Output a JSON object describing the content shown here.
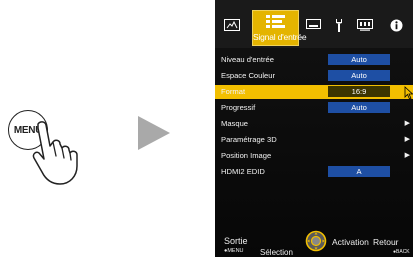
{
  "illustration": {
    "menu_button_label": "MENU"
  },
  "osd": {
    "active_tab_label": "Signal d'entrée",
    "tabs": [
      {
        "icon": "picture-icon"
      },
      {
        "icon": "input-signal-icon"
      },
      {
        "icon": "installation-icon"
      },
      {
        "icon": "setup-wrench-icon"
      },
      {
        "icon": "display-setup-icon"
      },
      {
        "icon": "info-icon"
      }
    ],
    "menu_items": [
      {
        "label": "Niveau d'entrée",
        "value": "Auto"
      },
      {
        "label": "Espace Couleur",
        "value": "Auto"
      },
      {
        "label": "Format",
        "value": "16:9"
      },
      {
        "label": "Progressif",
        "value": "Auto"
      },
      {
        "label": "Masque",
        "value": ""
      },
      {
        "label": "Paramétrage 3D",
        "value": ""
      },
      {
        "label": "Position Image",
        "value": ""
      },
      {
        "label": "HDMI2 EDID",
        "value": "A"
      }
    ],
    "selected_item": "Format",
    "footer": {
      "sortie": "Sortie",
      "menu": "●MENU",
      "selection": "Sélection",
      "activation": "Activation",
      "retour": "Retour",
      "back": "●BACK"
    },
    "colors": {
      "highlight": "#f2bf00",
      "value_box": "#1e4fa4",
      "background": "#0a0a0a"
    }
  }
}
